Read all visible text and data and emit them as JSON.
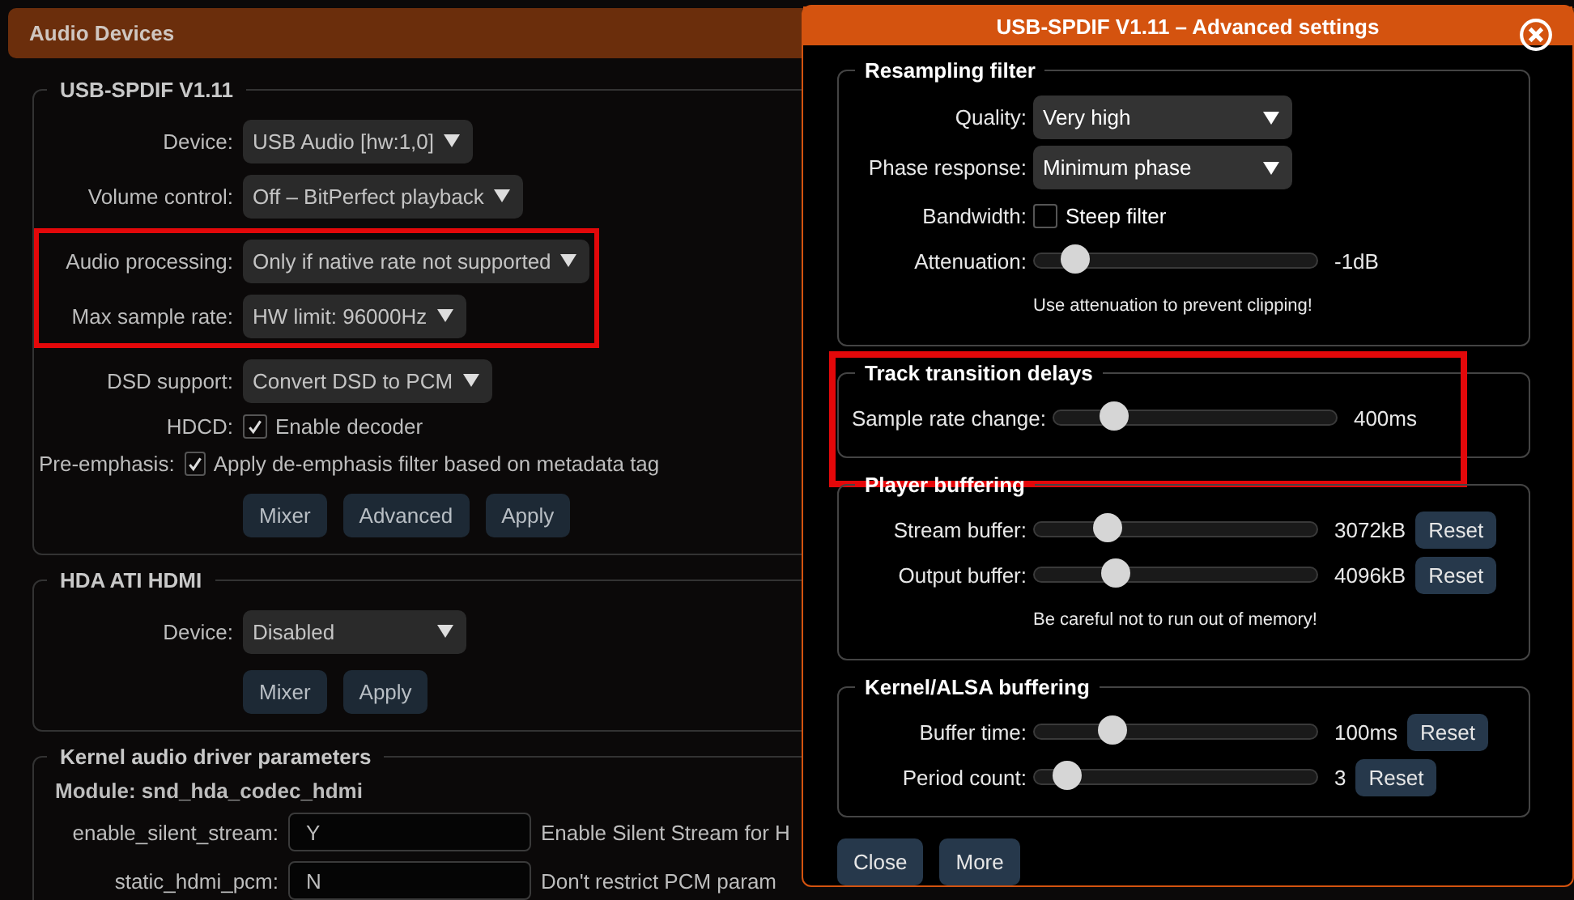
{
  "page_header": {
    "title": "Audio Devices"
  },
  "devices": [
    {
      "title": "USB-SPDIF V1.11",
      "groups": [
        {
          "highlighted": false,
          "fields": [
            {
              "kind": "select",
              "label": "Device:",
              "value": "USB Audio [hw:1,0]"
            },
            {
              "kind": "select",
              "label": "Volume control:",
              "value": "Off – BitPerfect playback"
            }
          ]
        },
        {
          "highlighted": true,
          "fields": [
            {
              "kind": "select",
              "label": "Audio processing:",
              "value": "Only if native rate not supported"
            },
            {
              "kind": "select",
              "label": "Max sample rate:",
              "value": "HW limit: 96000Hz"
            }
          ]
        },
        {
          "highlighted": false,
          "fields": [
            {
              "kind": "select",
              "label": "DSD support:",
              "value": "Convert DSD to PCM"
            },
            {
              "kind": "checkbox",
              "label": "HDCD:",
              "text": "Enable decoder",
              "checked": true
            },
            {
              "kind": "checkbox",
              "label": "Pre-emphasis:",
              "text": "Apply de-emphasis filter based on metadata tag",
              "checked": true
            }
          ]
        }
      ],
      "buttons": [
        "Mixer",
        "Advanced",
        "Apply"
      ]
    },
    {
      "title": "HDA ATI HDMI",
      "groups": [
        {
          "highlighted": false,
          "fields": [
            {
              "kind": "select",
              "label": "Device:",
              "value": "Disabled"
            }
          ]
        }
      ],
      "buttons": [
        "Mixer",
        "Apply"
      ]
    }
  ],
  "kernel_params": {
    "title": "Kernel audio driver parameters",
    "module": "Module: snd_hda_codec_hdmi",
    "params": [
      {
        "name": "enable_silent_stream:",
        "value": "Y",
        "description": "Enable Silent Stream for H"
      },
      {
        "name": "static_hdmi_pcm:",
        "value": "N",
        "description": "Don't restrict PCM param"
      }
    ]
  },
  "dialog": {
    "title": "USB-SPDIF V1.11 – Advanced settings",
    "sections": [
      {
        "title": "Resampling filter",
        "highlighted": false,
        "rows": [
          {
            "kind": "select",
            "label": "Quality:",
            "value": "Very high"
          },
          {
            "kind": "select",
            "label": "Phase response:",
            "value": "Minimum phase"
          },
          {
            "kind": "checkbox",
            "label": "Bandwidth:",
            "text": "Steep filter",
            "checked": false
          },
          {
            "kind": "slider",
            "label": "Attenuation:",
            "level": 0.1,
            "reading": "-1dB"
          },
          {
            "kind": "note",
            "text": "Use attenuation to prevent clipping!"
          }
        ]
      },
      {
        "title": "Track transition delays",
        "highlighted": true,
        "rows": [
          {
            "kind": "slider",
            "label": "Sample rate change:",
            "level": 0.18,
            "reading": "400ms"
          }
        ]
      },
      {
        "title": "Player buffering",
        "highlighted": false,
        "rows": [
          {
            "kind": "slider",
            "label": "Stream buffer:",
            "level": 0.23,
            "reading": "3072kB",
            "reset": "Reset"
          },
          {
            "kind": "slider",
            "label": "Output buffer:",
            "level": 0.26,
            "reading": "4096kB",
            "reset": "Reset"
          },
          {
            "kind": "note",
            "text": "Be careful not to run out of memory!"
          }
        ]
      },
      {
        "title": "Kernel/ALSA buffering",
        "highlighted": false,
        "rows": [
          {
            "kind": "slider",
            "label": "Buffer time:",
            "level": 0.25,
            "reading": "100ms",
            "reset": "Reset"
          },
          {
            "kind": "slider",
            "label": "Period count:",
            "level": 0.07,
            "reading": "3",
            "reset": "Reset"
          }
        ]
      }
    ],
    "buttons": [
      "Close",
      "More"
    ]
  }
}
